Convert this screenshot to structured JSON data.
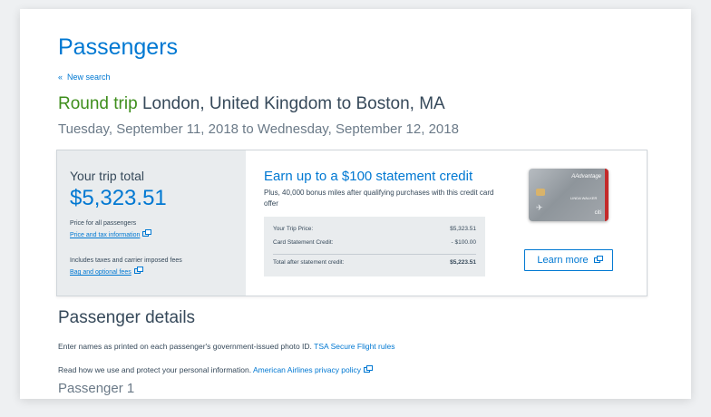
{
  "header": {
    "title": "Passengers",
    "new_search_chevron": "«",
    "new_search_label": "New search"
  },
  "trip": {
    "trip_type": "Round trip",
    "route": "London, United Kingdom to Boston, MA",
    "dates": "Tuesday, September 11, 2018 to Wednesday, September 12, 2018"
  },
  "summary": {
    "total_label": "Your trip total",
    "total_value": "$5,323.51",
    "price_for_all": "Price for all passengers",
    "price_tax_link": "Price and tax information",
    "includes_taxes": "Includes taxes and carrier imposed fees",
    "bag_fees_link": "Bag and optional fees"
  },
  "offer": {
    "title": "Earn up to a $100 statement credit",
    "subtitle": "Plus, 40,000 bonus miles after qualifying purchases with this credit card offer",
    "rows": [
      {
        "label": "Your Trip Price:",
        "value": "$5,323.51"
      },
      {
        "label": "Card Statement Credit:",
        "value": "- $100.00"
      }
    ],
    "total_row": {
      "label": "Total after statement credit:",
      "value": "$5,223.51"
    },
    "learn_more_label": "Learn more",
    "card": {
      "brand": "AAdvantage",
      "cardholder": "LINDA WALKER",
      "issuer": "citi",
      "stripe_color": "#c42a2a"
    }
  },
  "passenger_details": {
    "title": "Passenger details",
    "names_text": "Enter names as printed on each passenger's government-issued photo ID.",
    "tsa_link": "TSA Secure Flight rules",
    "privacy_text": "Read how we use and protect your personal information.",
    "privacy_link": "American Airlines privacy policy",
    "passenger_1_label": "Passenger 1"
  },
  "colors": {
    "accent_blue": "#0078d2",
    "trip_type_green": "#3e8e1c",
    "text_dark": "#36495a"
  }
}
